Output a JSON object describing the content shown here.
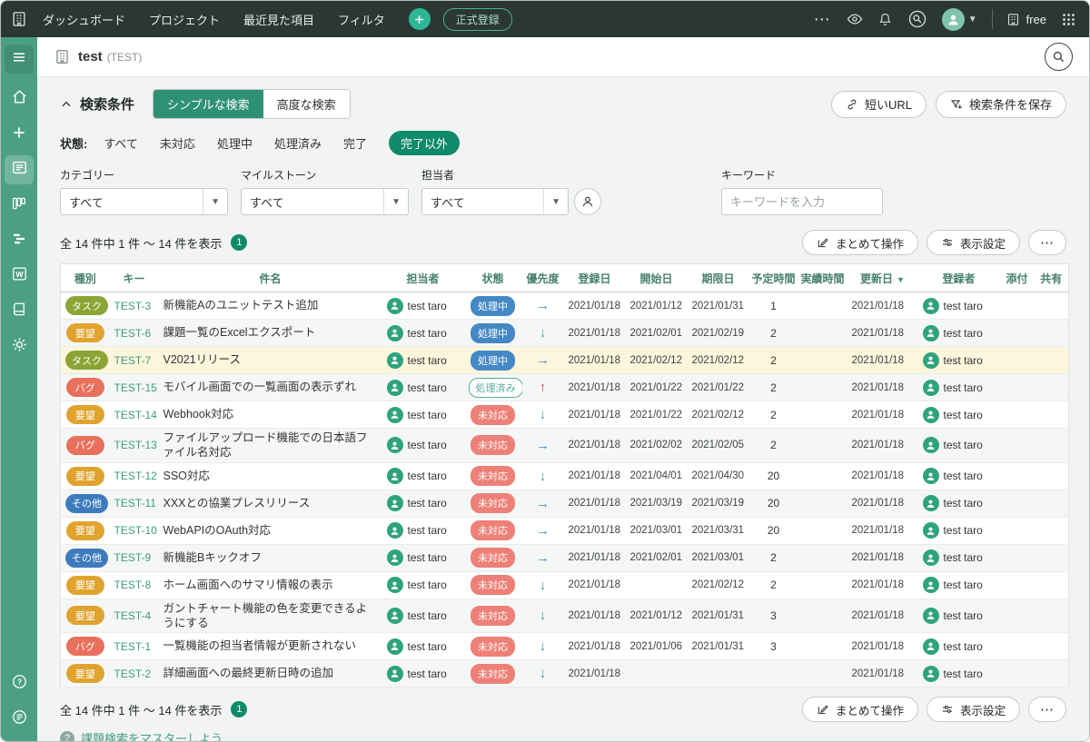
{
  "topbar": {
    "menu": [
      "ダッシュボード",
      "プロジェクト",
      "最近見た項目",
      "フィルタ"
    ],
    "badge": "正式登録",
    "more": "⋯",
    "plan": "free"
  },
  "project": {
    "name": "test",
    "key": "(TEST)"
  },
  "search": {
    "title": "検索条件",
    "tabs": [
      {
        "label": "シンプルな検索",
        "active": true
      },
      {
        "label": "高度な検索",
        "active": false
      }
    ],
    "actions": [
      {
        "label": "短いURL"
      },
      {
        "label": "検索条件を保存"
      }
    ],
    "status": {
      "label": "状態:",
      "options": [
        "すべて",
        "未対応",
        "処理中",
        "処理済み",
        "完了",
        "完了以外"
      ],
      "selected": "完了以外"
    },
    "filters": [
      {
        "label": "カテゴリー",
        "value": "すべて"
      },
      {
        "label": "マイルストーン",
        "value": "すべて"
      },
      {
        "label": "担当者",
        "value": "すべて"
      },
      {
        "label": "キーワード",
        "placeholder": "キーワードを入力"
      }
    ]
  },
  "results": {
    "summary": "全 14 件中 1 件 〜 14 件を表示",
    "page": "1",
    "actions": [
      "まとめて操作",
      "表示設定"
    ],
    "more": "⋯"
  },
  "table": {
    "columns": [
      "種別",
      "キー",
      "件名",
      "担当者",
      "状態",
      "優先度",
      "登録日",
      "開始日",
      "期限日",
      "予定時間",
      "実績時間",
      "更新日",
      "登録者",
      "添付",
      "共有"
    ],
    "sort_column": "更新日",
    "sort_caret": "▼",
    "rows": [
      {
        "type": "タスク",
        "key": "TEST-3",
        "title": "新機能Aのユニットテスト追加",
        "assignee": "test taro",
        "status": "処理中",
        "priority": "right",
        "created": "2021/01/18",
        "start": "2021/01/12",
        "due": "2021/01/31",
        "estimated": "1",
        "actual": "",
        "updated": "2021/01/18",
        "registrant": "test taro",
        "highlighted": false
      },
      {
        "type": "要望",
        "key": "TEST-6",
        "title": "課題一覧のExcelエクスポート",
        "assignee": "test taro",
        "status": "処理中",
        "priority": "down",
        "created": "2021/01/18",
        "start": "2021/02/01",
        "due": "2021/02/19",
        "estimated": "2",
        "actual": "",
        "updated": "2021/01/18",
        "registrant": "test taro",
        "highlighted": false
      },
      {
        "type": "タスク",
        "key": "TEST-7",
        "title": "V2021リリース",
        "assignee": "test taro",
        "status": "処理中",
        "priority": "right",
        "created": "2021/01/18",
        "start": "2021/02/12",
        "due": "2021/02/12",
        "estimated": "2",
        "actual": "",
        "updated": "2021/01/18",
        "registrant": "test taro",
        "highlighted": true
      },
      {
        "type": "バグ",
        "key": "TEST-15",
        "title": "モバイル画面での一覧画面の表示ずれ",
        "assignee": "test taro",
        "status": "処理済み",
        "priority": "up",
        "created": "2021/01/18",
        "start": "2021/01/22",
        "due": "2021/01/22",
        "estimated": "2",
        "actual": "",
        "updated": "2021/01/18",
        "registrant": "test taro",
        "highlighted": false
      },
      {
        "type": "要望",
        "key": "TEST-14",
        "title": "Webhook対応",
        "assignee": "test taro",
        "status": "未対応",
        "priority": "down",
        "created": "2021/01/18",
        "start": "2021/01/22",
        "due": "2021/02/12",
        "estimated": "2",
        "actual": "",
        "updated": "2021/01/18",
        "registrant": "test taro",
        "highlighted": false
      },
      {
        "type": "バグ",
        "key": "TEST-13",
        "title": "ファイルアップロード機能での日本語ファイル名対応",
        "assignee": "test taro",
        "status": "未対応",
        "priority": "right",
        "created": "2021/01/18",
        "start": "2021/02/02",
        "due": "2021/02/05",
        "estimated": "2",
        "actual": "",
        "updated": "2021/01/18",
        "registrant": "test taro",
        "highlighted": false
      },
      {
        "type": "要望",
        "key": "TEST-12",
        "title": "SSO対応",
        "assignee": "test taro",
        "status": "未対応",
        "priority": "down",
        "created": "2021/01/18",
        "start": "2021/04/01",
        "due": "2021/04/30",
        "estimated": "20",
        "actual": "",
        "updated": "2021/01/18",
        "registrant": "test taro",
        "highlighted": false
      },
      {
        "type": "その他",
        "key": "TEST-11",
        "title": "XXXとの協業プレスリリース",
        "assignee": "test taro",
        "status": "未対応",
        "priority": "right",
        "created": "2021/01/18",
        "start": "2021/03/19",
        "due": "2021/03/19",
        "estimated": "20",
        "actual": "",
        "updated": "2021/01/18",
        "registrant": "test taro",
        "highlighted": false
      },
      {
        "type": "要望",
        "key": "TEST-10",
        "title": "WebAPIのOAuth対応",
        "assignee": "test taro",
        "status": "未対応",
        "priority": "right",
        "created": "2021/01/18",
        "start": "2021/03/01",
        "due": "2021/03/31",
        "estimated": "20",
        "actual": "",
        "updated": "2021/01/18",
        "registrant": "test taro",
        "highlighted": false
      },
      {
        "type": "その他",
        "key": "TEST-9",
        "title": "新機能Bキックオフ",
        "assignee": "test taro",
        "status": "未対応",
        "priority": "right",
        "created": "2021/01/18",
        "start": "2021/02/01",
        "due": "2021/03/01",
        "estimated": "2",
        "actual": "",
        "updated": "2021/01/18",
        "registrant": "test taro",
        "highlighted": false
      },
      {
        "type": "要望",
        "key": "TEST-8",
        "title": "ホーム画面へのサマリ情報の表示",
        "assignee": "test taro",
        "status": "未対応",
        "priority": "down",
        "created": "2021/01/18",
        "start": "",
        "due": "2021/02/12",
        "estimated": "2",
        "actual": "",
        "updated": "2021/01/18",
        "registrant": "test taro",
        "highlighted": false
      },
      {
        "type": "要望",
        "key": "TEST-4",
        "title": "ガントチャート機能の色を変更できるようにする",
        "assignee": "test taro",
        "status": "未対応",
        "priority": "down",
        "created": "2021/01/18",
        "start": "2021/01/12",
        "due": "2021/01/31",
        "estimated": "3",
        "actual": "",
        "updated": "2021/01/18",
        "registrant": "test taro",
        "highlighted": false
      },
      {
        "type": "バグ",
        "key": "TEST-1",
        "title": "一覧機能の担当者情報が更新されない",
        "assignee": "test taro",
        "status": "未対応",
        "priority": "down",
        "created": "2021/01/18",
        "start": "2021/01/06",
        "due": "2021/01/31",
        "estimated": "3",
        "actual": "",
        "updated": "2021/01/18",
        "registrant": "test taro",
        "highlighted": false
      },
      {
        "type": "要望",
        "key": "TEST-2",
        "title": "詳細画面への最終更新日時の追加",
        "assignee": "test taro",
        "status": "未対応",
        "priority": "down",
        "created": "2021/01/18",
        "start": "",
        "due": "",
        "estimated": "",
        "actual": "",
        "updated": "2021/01/18",
        "registrant": "test taro",
        "highlighted": false
      }
    ]
  },
  "footer": {
    "help_label": "課題検索をマスターしよう"
  },
  "colors": {
    "brand_green": "#4ba084",
    "topbar_bg": "#2a3733",
    "active_tab": "#2e9173",
    "selected_status": "#108a69",
    "link": "#3f9c7d",
    "row_highlight": "#fcf6dd",
    "avatar": "#2fa37e",
    "types": {
      "タスク": "#8ba535",
      "要望": "#e0a32e",
      "バグ": "#e8705c",
      "その他": "#3e7bbd"
    },
    "statuses": {
      "未対応": {
        "bg": "#ed8077",
        "fg": "#ffffff",
        "border": "#ed8077"
      },
      "処理中": {
        "bg": "#4488c5",
        "fg": "#ffffff",
        "border": "#4488c5"
      },
      "処理済み": {
        "bg": "#ffffff",
        "fg": "#56ad9c",
        "border": "#56ad9c"
      }
    },
    "priorities": {
      "up": {
        "glyph": "↑",
        "color": "#dd4a37"
      },
      "right": {
        "glyph": "→",
        "color": "#4488c5"
      },
      "down": {
        "glyph": "↓",
        "color": "#3d98a8"
      }
    }
  }
}
